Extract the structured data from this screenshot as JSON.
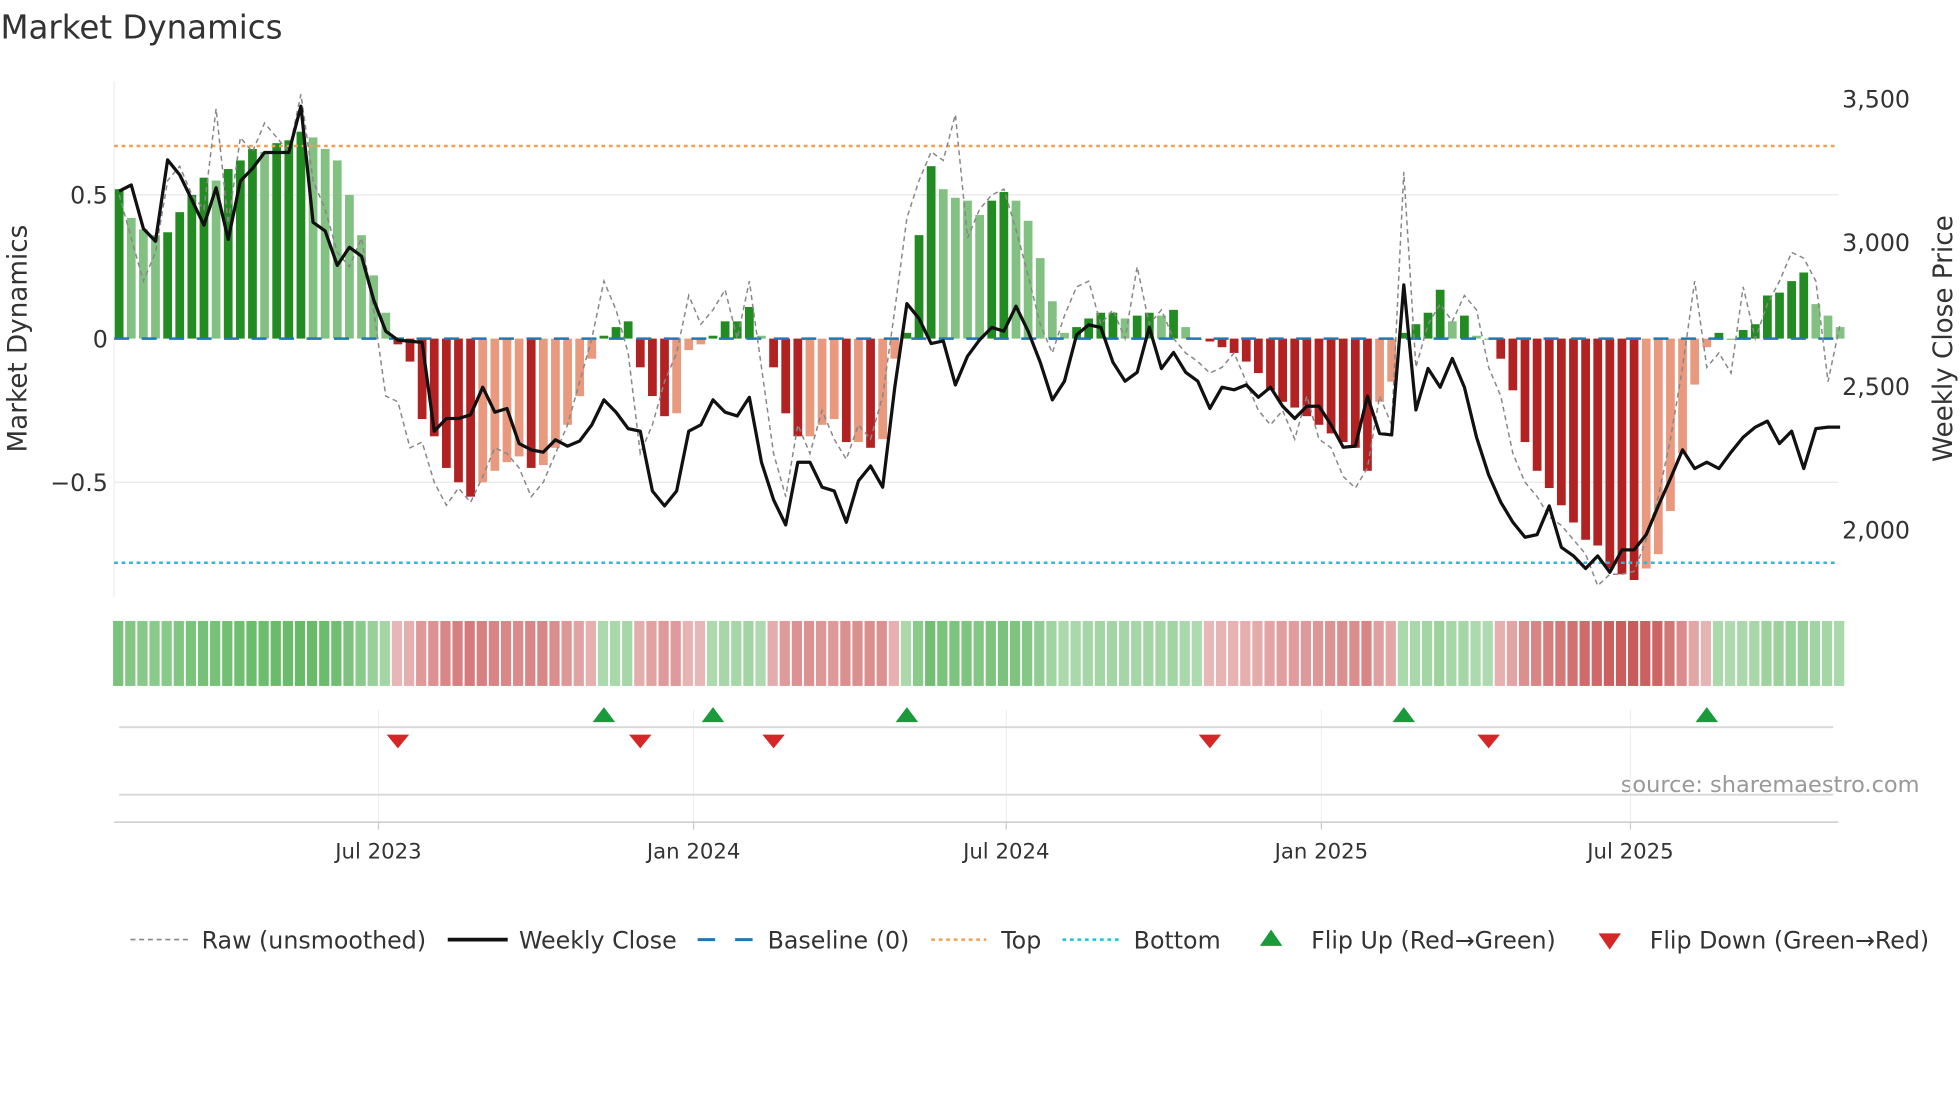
{
  "chart_data": {
    "type": "bar",
    "title": "Market Dynamics",
    "ylabel": "Market Dynamics",
    "y2label": "Weekly Close Price",
    "ylim": [
      -0.9,
      0.85
    ],
    "y2lim": [
      1810,
      3560
    ],
    "yticks": [
      {
        "v": 0.5,
        "label": "0.5"
      },
      {
        "v": 0,
        "label": "0"
      },
      {
        "v": -0.5,
        "label": "−0.5"
      }
    ],
    "y2ticks": [
      {
        "v": 3500,
        "label": "3,500"
      },
      {
        "v": 3000,
        "label": "3,000"
      },
      {
        "v": 2500,
        "label": "2,500"
      },
      {
        "v": 2000,
        "label": "2,000"
      }
    ],
    "xticks": [
      {
        "week": 21.4,
        "label": "Jul 2023"
      },
      {
        "week": 47.4,
        "label": "Jan 2024"
      },
      {
        "week": 73.2,
        "label": "Jul 2024"
      },
      {
        "week": 99.2,
        "label": "Jan 2025"
      },
      {
        "week": 124.7,
        "label": "Jul 2025"
      }
    ],
    "top_level": 0.67,
    "bottom_level": -0.78,
    "baseline": 0,
    "momentum": [
      0.52,
      0.42,
      0.38,
      0.36,
      0.37,
      0.44,
      0.5,
      0.56,
      0.55,
      0.59,
      0.62,
      0.66,
      0.65,
      0.68,
      0.69,
      0.72,
      0.7,
      0.66,
      0.62,
      0.5,
      0.36,
      0.22,
      0.09,
      -0.02,
      -0.08,
      -0.28,
      -0.34,
      -0.45,
      -0.5,
      -0.55,
      -0.5,
      -0.46,
      -0.43,
      -0.41,
      -0.45,
      -0.44,
      -0.38,
      -0.3,
      -0.2,
      -0.07,
      0.01,
      0.04,
      0.06,
      -0.1,
      -0.2,
      -0.27,
      -0.26,
      -0.04,
      -0.02,
      0.01,
      0.06,
      0.06,
      0.11,
      0.01,
      -0.1,
      -0.26,
      -0.34,
      -0.34,
      -0.3,
      -0.28,
      -0.36,
      -0.36,
      -0.38,
      -0.35,
      -0.07,
      0.02,
      0.36,
      0.6,
      0.52,
      0.49,
      0.48,
      0.43,
      0.48,
      0.51,
      0.48,
      0.41,
      0.28,
      0.13,
      0.02,
      0.04,
      0.07,
      0.09,
      0.09,
      0.07,
      0.08,
      0.09,
      0.08,
      0.1,
      0.04,
      0.0,
      -0.01,
      -0.03,
      -0.05,
      -0.08,
      -0.12,
      -0.18,
      -0.22,
      -0.24,
      -0.27,
      -0.3,
      -0.33,
      -0.36,
      -0.38,
      -0.46,
      -0.22,
      -0.15,
      0.02,
      0.05,
      0.09,
      0.17,
      0.06,
      0.08,
      0.01,
      0.0,
      -0.07,
      -0.18,
      -0.36,
      -0.46,
      -0.52,
      -0.58,
      -0.64,
      -0.7,
      -0.72,
      -0.8,
      -0.82,
      -0.84,
      -0.8,
      -0.75,
      -0.6,
      -0.4,
      -0.16,
      -0.03,
      0.02,
      0.0,
      0.03,
      0.05,
      0.15,
      0.16,
      0.2,
      0.23,
      0.12,
      0.08,
      0.04
    ],
    "raw": [
      0.5,
      0.35,
      0.2,
      0.3,
      0.55,
      0.6,
      0.5,
      0.45,
      0.8,
      0.4,
      0.7,
      0.65,
      0.75,
      0.7,
      0.65,
      0.85,
      0.55,
      0.45,
      0.3,
      0.25,
      0.35,
      0.1,
      -0.2,
      -0.22,
      -0.38,
      -0.36,
      -0.5,
      -0.58,
      -0.52,
      -0.57,
      -0.48,
      -0.38,
      -0.4,
      -0.45,
      -0.55,
      -0.5,
      -0.4,
      -0.3,
      -0.15,
      0.0,
      0.2,
      0.1,
      -0.05,
      -0.4,
      -0.3,
      -0.15,
      -0.05,
      0.15,
      0.05,
      0.1,
      0.17,
      0.0,
      0.2,
      -0.1,
      -0.4,
      -0.55,
      -0.3,
      -0.4,
      -0.25,
      -0.35,
      -0.42,
      -0.3,
      -0.35,
      -0.2,
      0.1,
      0.42,
      0.55,
      0.65,
      0.62,
      0.78,
      0.35,
      0.45,
      0.5,
      0.52,
      0.38,
      0.22,
      0.05,
      -0.05,
      0.08,
      0.18,
      0.2,
      0.05,
      0.1,
      0.0,
      0.25,
      0.05,
      0.1,
      0.0,
      -0.05,
      -0.08,
      -0.12,
      -0.1,
      -0.05,
      -0.15,
      -0.25,
      -0.3,
      -0.25,
      -0.35,
      -0.2,
      -0.35,
      -0.38,
      -0.48,
      -0.52,
      -0.45,
      -0.2,
      -0.3,
      0.58,
      -0.1,
      0.05,
      0.12,
      0.06,
      0.15,
      0.1,
      -0.1,
      -0.2,
      -0.4,
      -0.5,
      -0.55,
      -0.62,
      -0.65,
      -0.7,
      -0.75,
      -0.86,
      -0.82,
      -0.82,
      -0.81,
      -0.7,
      -0.55,
      -0.35,
      -0.1,
      0.2,
      -0.1,
      -0.05,
      -0.12,
      0.18,
      0.0,
      0.12,
      0.2,
      0.3,
      0.28,
      0.2,
      -0.15,
      0.05
    ],
    "weekly_close": [
      3178,
      3200,
      3048,
      3004,
      3287,
      3235,
      3148,
      3060,
      3190,
      3010,
      3213,
      3257,
      3313,
      3313,
      3313,
      3474,
      3070,
      3040,
      2920,
      2983,
      2952,
      2800,
      2691,
      2660,
      2656,
      2652,
      2343,
      2387,
      2387,
      2400,
      2496,
      2409,
      2422,
      2300,
      2278,
      2270,
      2313,
      2291,
      2309,
      2365,
      2452,
      2409,
      2352,
      2343,
      2135,
      2083,
      2135,
      2343,
      2365,
      2452,
      2409,
      2396,
      2461,
      2235,
      2104,
      2017,
      2235,
      2235,
      2148,
      2135,
      2026,
      2170,
      2222,
      2148,
      2496,
      2787,
      2735,
      2648,
      2657,
      2504,
      2604,
      2661,
      2704,
      2691,
      2778,
      2691,
      2583,
      2452,
      2517,
      2678,
      2713,
      2704,
      2583,
      2517,
      2548,
      2704,
      2561,
      2617,
      2548,
      2517,
      2422,
      2496,
      2487,
      2504,
      2461,
      2496,
      2430,
      2387,
      2430,
      2430,
      2365,
      2287,
      2291,
      2465,
      2335,
      2330,
      2852,
      2417,
      2561,
      2496,
      2596,
      2496,
      2322,
      2191,
      2096,
      2026,
      1974,
      1983,
      2083,
      1939,
      1909,
      1865,
      1909,
      1852,
      1930,
      1930,
      1983,
      2083,
      2178,
      2278,
      2213,
      2235,
      2213,
      2270,
      2322,
      2357,
      2378,
      2300,
      2343,
      2213,
      2352,
      2357,
      2357
    ],
    "flip_up_weeks": [
      40,
      49,
      65,
      106,
      131
    ],
    "flip_down_weeks": [
      23,
      43,
      54,
      90,
      113
    ],
    "legend": [
      {
        "key": "raw",
        "label": "Raw (unsmoothed)"
      },
      {
        "key": "close",
        "label": "Weekly Close"
      },
      {
        "key": "baseline",
        "label": "Baseline (0)"
      },
      {
        "key": "top",
        "label": "Top"
      },
      {
        "key": "bottom",
        "label": "Bottom"
      },
      {
        "key": "up",
        "label": "Flip Up (Red→Green)"
      },
      {
        "key": "down",
        "label": "Flip Down (Green→Red)"
      }
    ],
    "legend_placement": "bottom",
    "source": "source: sharemaestro.com",
    "colors": {
      "green_strong": "#228b22",
      "green_weak": "#82c182",
      "red_strong": "#b22222",
      "red_weak": "#e8997e",
      "raw": "#888888",
      "close": "#111111",
      "baseline": "#1f77b4",
      "top": "#f0a050",
      "bottom": "#22c0d8",
      "flip_up": "#1a9a3a",
      "flip_down": "#d62728"
    }
  }
}
